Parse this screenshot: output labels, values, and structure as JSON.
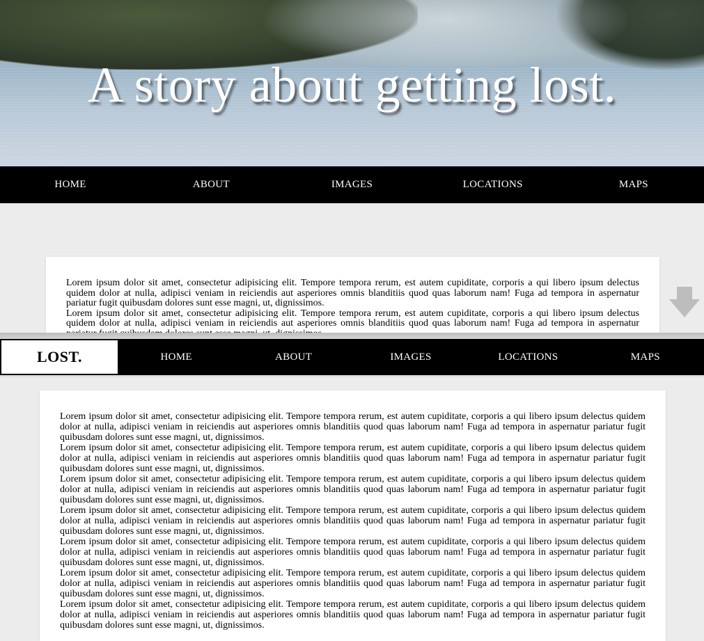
{
  "hero": {
    "title": "A story about getting lost."
  },
  "nav": {
    "items": [
      {
        "label": "HOME"
      },
      {
        "label": "ABOUT"
      },
      {
        "label": "IMAGES"
      },
      {
        "label": "LOCATIONS"
      },
      {
        "label": "MAPS"
      }
    ]
  },
  "sticky_header": {
    "brand": "LOST."
  },
  "content": {
    "paragraph": "Lorem ipsum dolor sit amet, consectetur adipisicing elit. Tempore tempora rerum, est autem cupiditate, corporis a qui libero ipsum delectus quidem dolor at nulla, adipisci veniam in reiciendis aut asperiores omnis blanditiis quod quas laborum nam! Fuga ad tempora in aspernatur pariatur fugit quibusdam dolores sunt esse magni, ut, dignissimos."
  },
  "icons": {
    "scroll": "arrow-down-icon"
  },
  "colors": {
    "nav_background": "#000000",
    "page_background": "#ececec",
    "card_background": "#ffffff",
    "arrow": "#bdbdbd"
  }
}
